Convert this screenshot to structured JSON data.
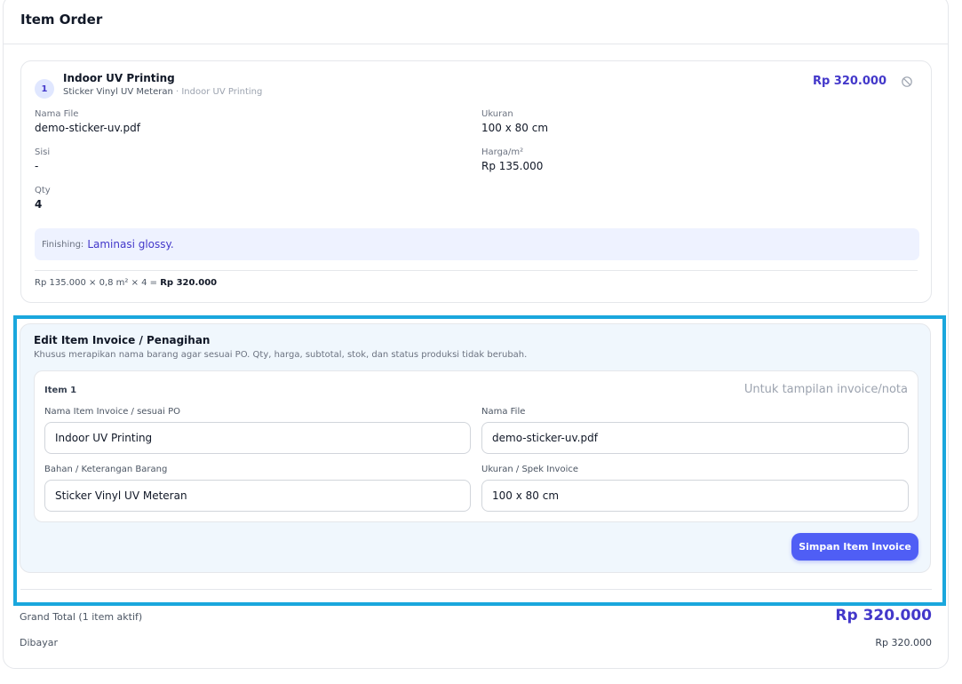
{
  "section_title": "Item Order",
  "item": {
    "number": "1",
    "title": "Indoor UV Printing",
    "material": "Sticker Vinyl UV Meteran",
    "separator": " · ",
    "category": "Indoor UV Printing",
    "price": "Rp 320.000",
    "fields": {
      "file_label": "Nama File",
      "file_value": "demo-sticker-uv.pdf",
      "size_label": "Ukuran",
      "size_value": "100 x 80 cm",
      "side_label": "Sisi",
      "side_value": "-",
      "price_label": "Harga/m²",
      "price_value": "Rp 135.000",
      "qty_label": "Qty",
      "qty_value": "4"
    },
    "finishing_label": "Finishing:",
    "finishing_value": "Laminasi glossy.",
    "calc_text": "Rp 135.000 × 0,8 m² × 4 = ",
    "calc_total": "Rp 320.000"
  },
  "edit_invoice": {
    "title": "Edit Item Invoice / Penagihan",
    "description": "Khusus merapikan nama barang agar sesuai PO. Qty, harga, subtotal, stok, dan status produksi tidak berubah.",
    "item_label": "Item 1",
    "hint": "Untuk tampilan invoice/nota",
    "fields": {
      "name_label": "Nama Item Invoice / sesuai PO",
      "name_value": "Indoor UV Printing",
      "file_label": "Nama File",
      "file_value": "demo-sticker-uv.pdf",
      "material_label": "Bahan / Keterangan Barang",
      "material_value": "Sticker Vinyl UV Meteran",
      "spec_label": "Ukuran / Spek Invoice",
      "spec_value": "100 x 80 cm"
    },
    "save_button": "Simpan Item Invoice"
  },
  "totals": {
    "grand_label": "Grand Total (1 item aktif)",
    "grand_value": "Rp 320.000",
    "paid_label": "Dibayar",
    "paid_value": "Rp 320.000"
  },
  "icons": {
    "remove": "ban-icon"
  },
  "colors": {
    "accent": "#4338ca",
    "button": "#4f5ef5",
    "highlight_border": "#1aa7dd",
    "finishing_bg": "#eef2ff",
    "edit_panel_bg": "#f0f7fd"
  }
}
